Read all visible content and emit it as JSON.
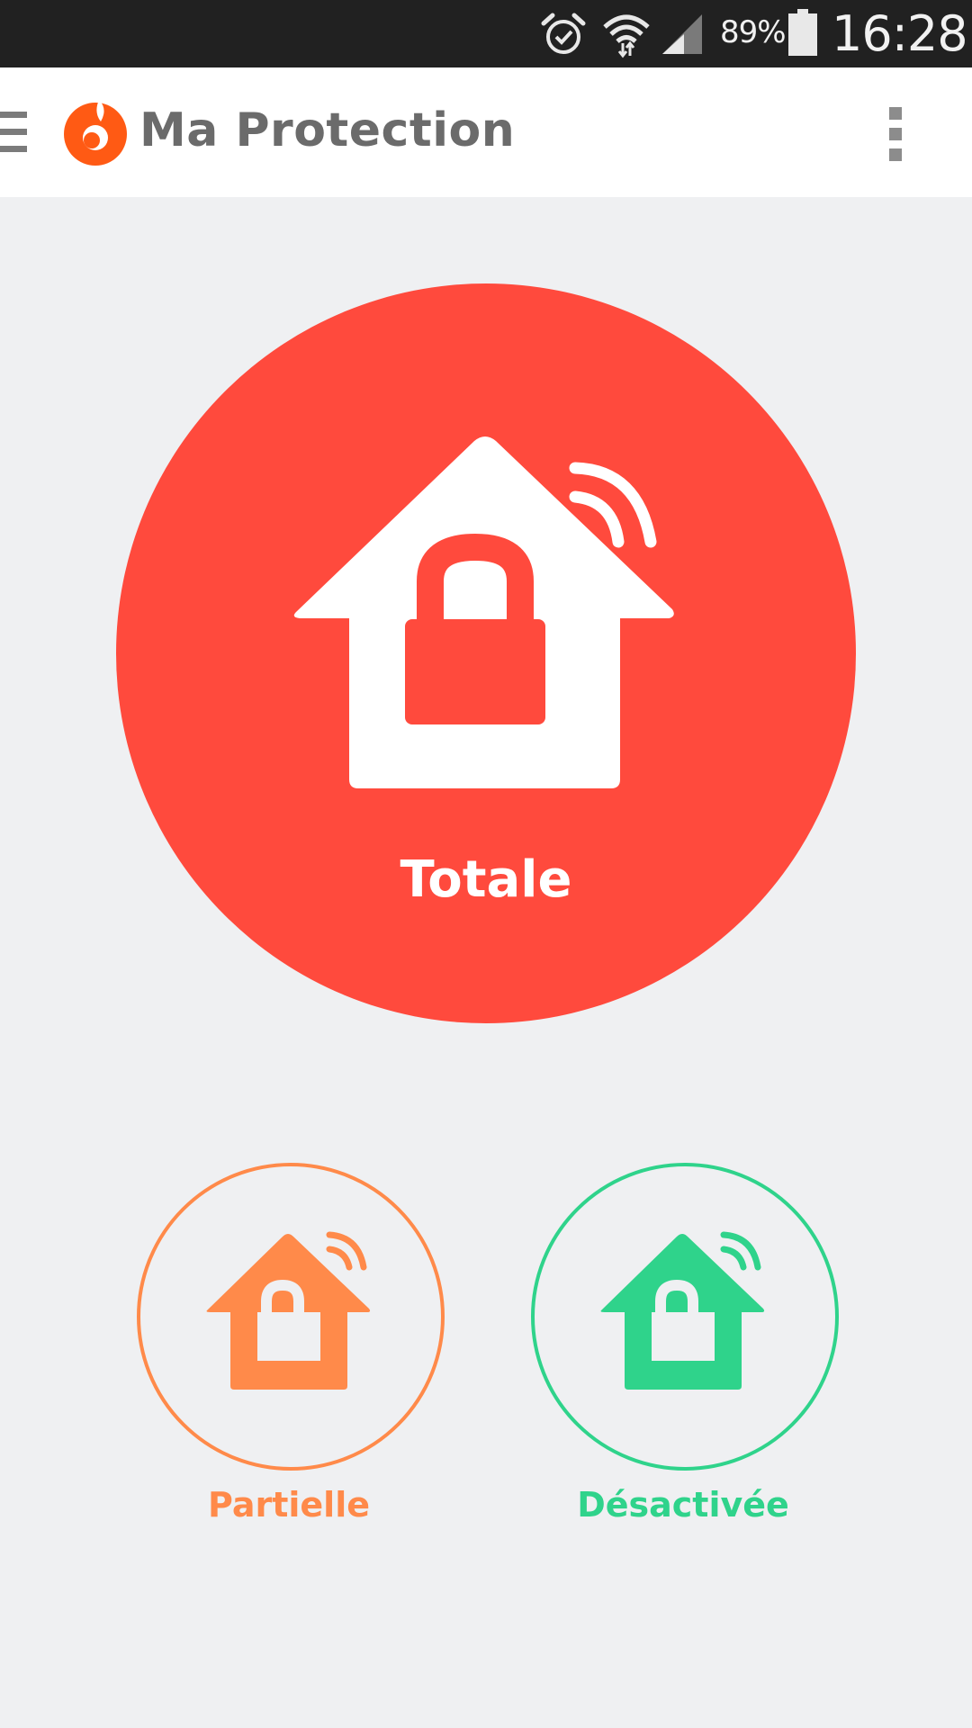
{
  "status_bar": {
    "battery_percent": "89%",
    "time": "16:28",
    "icons": [
      "alarm-icon",
      "wifi-icon",
      "signal-icon",
      "battery-icon"
    ]
  },
  "app_bar": {
    "title": "Ma Protection",
    "icons": [
      "menu-icon",
      "logo-icon",
      "overflow-menu-icon"
    ]
  },
  "modes": {
    "total": {
      "label": "Totale",
      "color": "#ff4a3d",
      "icon": "house-locked-icon",
      "selected": true
    },
    "partial": {
      "label": "Partielle",
      "color": "#ff8a4a",
      "icon": "house-unlocked-icon"
    },
    "off": {
      "label": "Désactivée",
      "color": "#2fd38b",
      "icon": "house-unlocked-icon"
    }
  },
  "colors": {
    "background": "#eff0f2",
    "status_bar": "#212121",
    "logo_accent": "#ff5a14",
    "title_text": "#6b6b6b"
  }
}
